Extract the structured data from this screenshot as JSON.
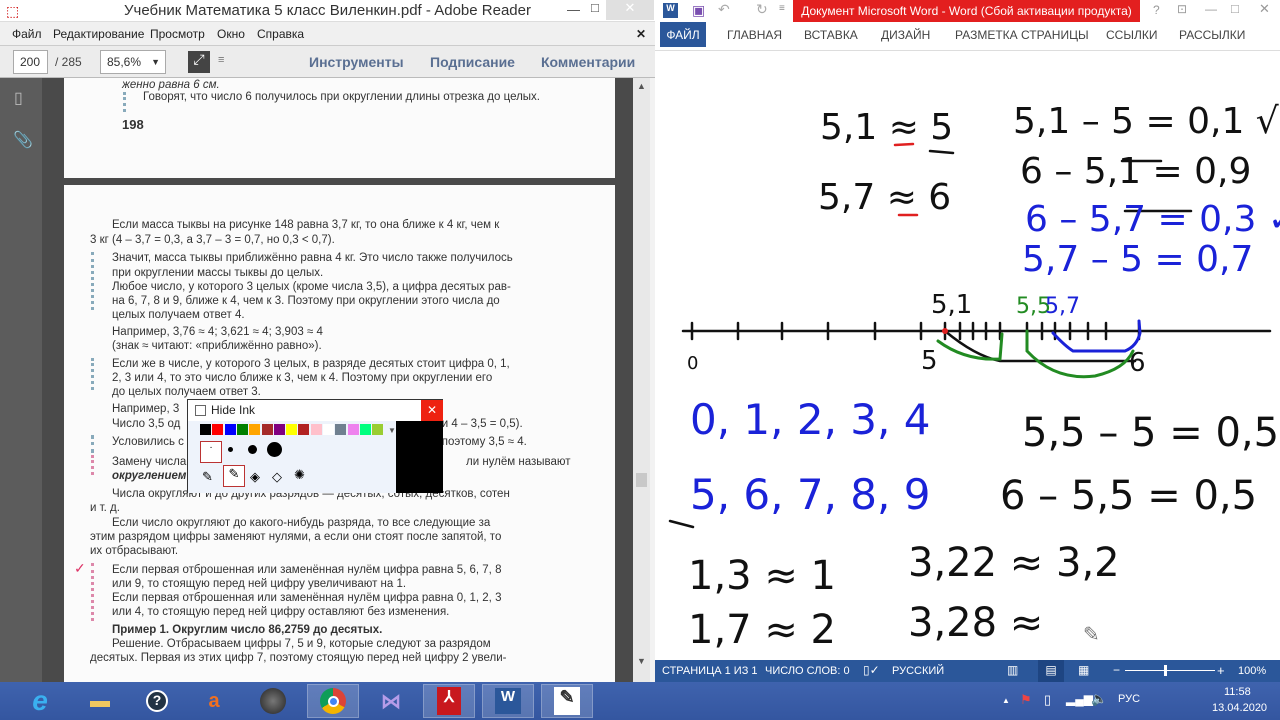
{
  "adobe": {
    "title": "Учебник Математика 5 класс Виленкин.pdf - Adobe Reader",
    "menu": [
      "Файл",
      "Редактирование",
      "Просмотр",
      "Окно",
      "Справка"
    ],
    "page_current": "200",
    "page_total": "/ 285",
    "zoom": "85,6%",
    "tools": "Инструменты",
    "sign": "Подписание",
    "comments": "Комментарии",
    "page1": [
      "женно равна 6 см.",
      "Говорят, что число 6 получилось при округлении длины отрезка до целых.",
      "198"
    ],
    "page2": [
      "Если масса тыквы на рисунке 148 равна 3,7 кг, то она ближе к 4 кг, чем к",
      "3 кг (4 – 3,7 = 0,3, а 3,7 – 3 = 0,7, но 0,3 < 0,7).",
      "Значит, масса тыквы приближённо равна 4 кг. Это число также получилось",
      "при округлении массы тыквы до целых.",
      "Любое число, у которого 3 целых (кроме числа 3,5), а цифра десятых рав-",
      "на 6, 7, 8 и 9, ближе к 4, чем к 3. Поэтому при округлении этого числа до",
      "целых получаем ответ 4.",
      "Например,  3,76 ≈ 4; 3,621 ≈ 4; 3,903 ≈ 4",
      "(знак ≈ читают: «приближённо равно»).",
      "Если же в числе, у которого 3 целых, в разряде десятых стоит цифра 0, 1,",
      "2, 3 или 4, то это число ближе к 3, чем к 4. Поэтому при округлении его",
      "до целых получаем ответ 3.",
      "Например, 3",
      "Число 3,5 од",
      ",5 и 4 – 3,5 = 0,5).",
      "Условились с",
      "4, поэтому 3,5 ≈ 4.",
      "Замену числа",
      "ли нулём называют",
      "округлением",
      "Числа округляют и до других разрядов — десятых, сотых, десятков, сотен",
      "и т. д.",
      "Если число округляют до какого-нибудь разряда, то все следующие за",
      "этим разрядом цифры заменяют нулями, а если они стоят после запятой, то",
      "их отбрасывают.",
      "Если первая отброшенная или заменённая нулём цифра равна 5, 6, 7, 8",
      "или 9, то стоящую перед ней цифру увеличивают на 1.",
      "Если первая отброшенная или заменённая нулём цифра равна 0, 1, 2, 3",
      "или 4, то стоящую перед ней цифру оставляют без изменения.",
      "Пример 1. Округлим число 86,2759 до десятых.",
      "Решение. Отбрасываем цифры 7, 5 и 9, которые следуют за разрядом",
      "десятых. Первая из этих цифр 7, поэтому стоящую перед ней цифру 2 увели-"
    ]
  },
  "ink_toolbar": {
    "hide_ink": "Hide Ink",
    "colors": [
      "#000000",
      "#ff0000",
      "#0000ff",
      "#008000",
      "#ffa500",
      "#a52a2a",
      "#800080",
      "#ffff00",
      "#b22222",
      "#ffc0cb",
      "#ffffff",
      "#708090",
      "#ee82ee",
      "#00ff7f",
      "#9acd32"
    ]
  },
  "word": {
    "title": "Документ Microsoft Word -  Word (Сбой активации продукта)",
    "tabs": [
      "ФАЙЛ",
      "ГЛАВНАЯ",
      "ВСТАВКА",
      "ДИЗАЙН",
      "РАЗМЕТКА СТРАНИЦЫ",
      "ССЫЛКИ",
      "РАССЫЛКИ"
    ],
    "status": {
      "page": "СТРАНИЦА 1 ИЗ 1",
      "words": "ЧИСЛО СЛОВ: 0",
      "lang": "РУССКИЙ",
      "zoom": "100%"
    },
    "ink": {
      "black": "#111111",
      "blue": "#1a22d8",
      "green": "#228b22",
      "red": "#e02020",
      "notes": [
        "5,1 ≈ 5",
        "5,7 ≈ 6",
        "5,1 – 5 = 0,1 √",
        "6 – 5,1 = 0,9",
        "6 – 5,7 = 0,3 ✓",
        "5,7 – 5 = 0,7",
        "5,1",
        "5,5",
        "5,7",
        "0",
        "5",
        "6",
        "0, 1, 2, 3, 4",
        "5, 6, 7, 8, 9",
        "5,5 – 5 = 0,5",
        "6 – 5,5 = 0,5",
        "1,3 ≈ 1",
        "1,7 ≈ 2",
        "3,22 ≈ 3,2",
        "3,28 ≈"
      ]
    }
  },
  "taskbar": {
    "apps": [
      "internet-explorer",
      "file-explorer",
      "help",
      "avast",
      "media",
      "chrome",
      "visual-studio",
      "adobe-reader",
      "word",
      "ink-pen"
    ],
    "lang": "РУС",
    "time": "11:58",
    "date": "13.04.2020"
  }
}
